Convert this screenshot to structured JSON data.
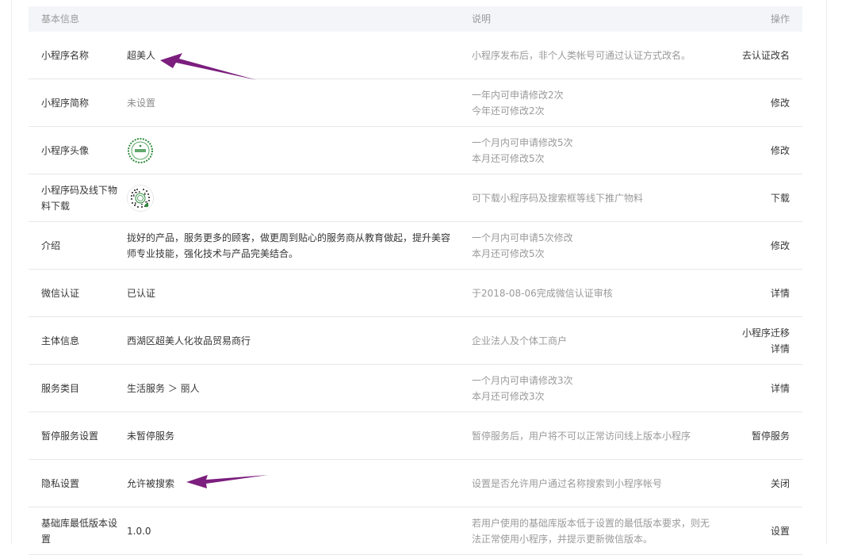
{
  "header": {
    "col_info": "基本信息",
    "col_desc": "说明",
    "col_action": "操作"
  },
  "rows": [
    {
      "label": "小程序名称",
      "value": "超美人",
      "desc_lines": [
        "小程序发布后，非个人类帐号可通过认证方式改名。"
      ],
      "action_lines": [
        "去认证改名"
      ]
    },
    {
      "label": "小程序简称",
      "value": "未设置",
      "desc_lines": [
        "一年内可申请修改2次",
        "今年还可修改2次"
      ],
      "action_lines": [
        "修改"
      ]
    },
    {
      "label": "小程序头像",
      "value": "",
      "desc_lines": [
        "一个月内可申请修改5次",
        "本月还可修改5次"
      ],
      "action_lines": [
        "修改"
      ]
    },
    {
      "label": "小程序码及线下物料下载",
      "value": "",
      "desc_lines": [
        "可下载小程序码及搜索框等线下推广物料"
      ],
      "action_lines": [
        "下载"
      ]
    },
    {
      "label": "介绍",
      "value": "拢好的产品，服务更多的顾客，做更周到贴心的服务商从教育做起，提升美容师专业技能，强化技术与产品完美结合。",
      "desc_lines": [
        "一个月内可申请5次修改",
        "本月还可修改5次"
      ],
      "action_lines": [
        "修改"
      ]
    },
    {
      "label": "微信认证",
      "value": "已认证",
      "desc_lines": [
        "于2018-08-06完成微信认证审核"
      ],
      "action_lines": [
        "详情"
      ]
    },
    {
      "label": "主体信息",
      "value": "西湖区超美人化妆品贸易商行",
      "desc_lines": [
        "企业法人及个体工商户"
      ],
      "action_lines": [
        "小程序迁移",
        "详情"
      ]
    },
    {
      "label": "服务类目",
      "value": "生活服务 ＞ 丽人",
      "desc_lines": [
        "一个月内可申请修改3次",
        "本月还可修改3次"
      ],
      "action_lines": [
        "详情"
      ]
    },
    {
      "label": "暂停服务设置",
      "value": "未暂停服务",
      "desc_lines": [
        "暂停服务后，用户将不可以正常访问线上版本小程序"
      ],
      "action_lines": [
        "暂停服务"
      ]
    },
    {
      "label": "隐私设置",
      "value": "允许被搜索",
      "desc_lines": [
        "设置是否允许用户通过名称搜索到小程序帐号"
      ],
      "action_lines": [
        "关闭"
      ]
    },
    {
      "label": "基础库最低版本设置",
      "value": "1.0.0",
      "desc_lines": [
        "若用户使用的基础库版本低于设置的最低版本要求，则无",
        "法正常使用小程序，并提示更新微信版本。"
      ],
      "action_lines": [
        "设置"
      ]
    }
  ],
  "icons": {
    "avatar": "mini-program-avatar-icon",
    "qrcode": "mini-program-code-icon",
    "arrow": "annotation-arrow"
  },
  "colors": {
    "annotation": "#7b1e7e",
    "avatar_green": "#2e8b3d",
    "header_bg": "#f4f5f9"
  }
}
